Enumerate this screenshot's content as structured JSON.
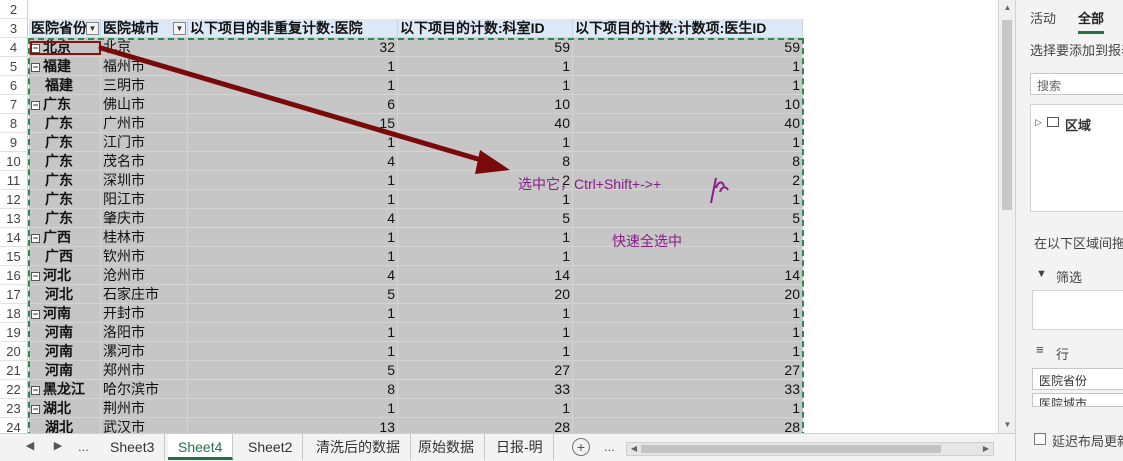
{
  "sheet": {
    "top_row": "2",
    "header": {
      "row_num": "3",
      "col1": "医院省份",
      "col2": "医院城市",
      "col3": "以下项目的非重复计数:医院",
      "col4": "以下项目的计数:科室ID",
      "col5": "以下项目的计数:计数项:医生ID"
    },
    "rows": [
      {
        "n": "4",
        "prov": "北京",
        "city": "北京",
        "v1": "32",
        "v2": "59",
        "v3": "59",
        "group": true
      },
      {
        "n": "5",
        "prov": "福建",
        "city": "福州市",
        "v1": "1",
        "v2": "1",
        "v3": "1",
        "group": true
      },
      {
        "n": "6",
        "prov": "福建",
        "city": "三明市",
        "v1": "1",
        "v2": "1",
        "v3": "1",
        "group": false
      },
      {
        "n": "7",
        "prov": "广东",
        "city": "佛山市",
        "v1": "6",
        "v2": "10",
        "v3": "10",
        "group": true
      },
      {
        "n": "8",
        "prov": "广东",
        "city": "广州市",
        "v1": "15",
        "v2": "40",
        "v3": "40",
        "group": false
      },
      {
        "n": "9",
        "prov": "广东",
        "city": "江门市",
        "v1": "1",
        "v2": "1",
        "v3": "1",
        "group": false
      },
      {
        "n": "10",
        "prov": "广东",
        "city": "茂名市",
        "v1": "4",
        "v2": "8",
        "v3": "8",
        "group": false
      },
      {
        "n": "11",
        "prov": "广东",
        "city": "深圳市",
        "v1": "1",
        "v2": "2",
        "v3": "2",
        "group": false
      },
      {
        "n": "12",
        "prov": "广东",
        "city": "阳江市",
        "v1": "1",
        "v2": "1",
        "v3": "1",
        "group": false
      },
      {
        "n": "13",
        "prov": "广东",
        "city": "肇庆市",
        "v1": "4",
        "v2": "5",
        "v3": "5",
        "group": false
      },
      {
        "n": "14",
        "prov": "广西",
        "city": "桂林市",
        "v1": "1",
        "v2": "1",
        "v3": "1",
        "group": true
      },
      {
        "n": "15",
        "prov": "广西",
        "city": "钦州市",
        "v1": "1",
        "v2": "1",
        "v3": "1",
        "group": false
      },
      {
        "n": "16",
        "prov": "河北",
        "city": "沧州市",
        "v1": "4",
        "v2": "14",
        "v3": "14",
        "group": true
      },
      {
        "n": "17",
        "prov": "河北",
        "city": "石家庄市",
        "v1": "5",
        "v2": "20",
        "v3": "20",
        "group": false
      },
      {
        "n": "18",
        "prov": "河南",
        "city": "开封市",
        "v1": "1",
        "v2": "1",
        "v3": "1",
        "group": true
      },
      {
        "n": "19",
        "prov": "河南",
        "city": "洛阳市",
        "v1": "1",
        "v2": "1",
        "v3": "1",
        "group": false
      },
      {
        "n": "20",
        "prov": "河南",
        "city": "漯河市",
        "v1": "1",
        "v2": "1",
        "v3": "1",
        "group": false
      },
      {
        "n": "21",
        "prov": "河南",
        "city": "郑州市",
        "v1": "5",
        "v2": "27",
        "v3": "27",
        "group": false
      },
      {
        "n": "22",
        "prov": "黑龙江",
        "city": "哈尔滨市",
        "v1": "8",
        "v2": "33",
        "v3": "33",
        "group": true
      },
      {
        "n": "23",
        "prov": "湖北",
        "city": "荆州市",
        "v1": "1",
        "v2": "1",
        "v3": "1",
        "group": true
      },
      {
        "n": "24",
        "prov": "湖北",
        "city": "武汉市",
        "v1": "13",
        "v2": "28",
        "v3": "28",
        "group": false
      }
    ]
  },
  "annotations": {
    "note1": "选中它，Ctrl+Shift+->+",
    "note2": "快速全选中",
    "arrow_color": "#7a0a0a",
    "text_color": "#8a1c8a"
  },
  "tabs": {
    "ellipsis": "...",
    "items": [
      "Sheet3",
      "Sheet4",
      "Sheet2",
      "清洗后的数据",
      "原始数据",
      "日报-明"
    ],
    "active": "Sheet4",
    "add": "+"
  },
  "pane": {
    "tab_active": "活动",
    "tab_all": "全部",
    "hint": "选择要添加到报表",
    "search_placeholder": "搜索",
    "tree_item": "区域",
    "drag_hint": "在以下区域间拖动",
    "filter_label": "筛选",
    "rows_label": "行",
    "row_field1": "医院省份",
    "row_field2": "医院城市",
    "defer_label": "延迟布局更新"
  }
}
